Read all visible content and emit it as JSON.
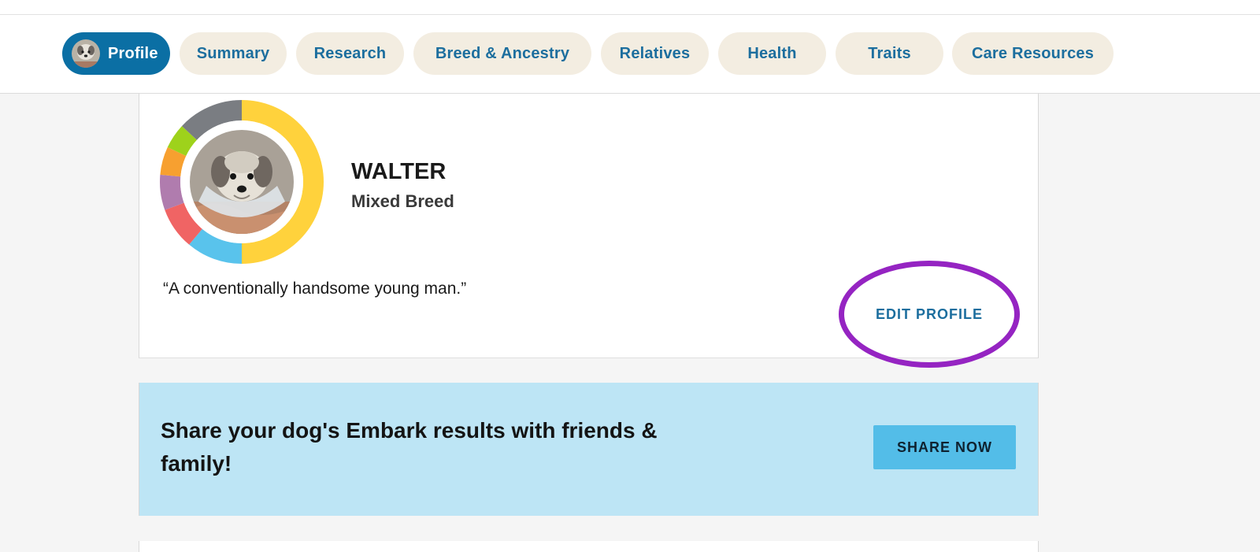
{
  "nav": {
    "tabs": [
      {
        "label": "Profile",
        "active": true
      },
      {
        "label": "Summary"
      },
      {
        "label": "Research"
      },
      {
        "label": "Breed & Ancestry"
      },
      {
        "label": "Relatives"
      },
      {
        "label": "Health"
      },
      {
        "label": "Traits"
      },
      {
        "label": "Care Resources"
      }
    ]
  },
  "profile": {
    "name": "WALTER",
    "breed": "Mixed Breed",
    "quote": "“A conventionally handsome young man.”",
    "edit_label": "EDIT PROFILE",
    "ancestry_ring_colors": [
      "#ffd23c",
      "#59c3ec",
      "#f06464",
      "#b07cae",
      "#f7a030",
      "#9ed21b",
      "#7a7d82"
    ]
  },
  "share": {
    "text": "Share your dog's Embark results with friends & family!",
    "button_label": "SHARE NOW"
  },
  "colors": {
    "nav_active": "#0b6fa4",
    "nav_inactive_bg": "#f3ede1",
    "link_blue": "#1c6e9e",
    "highlight_purple": "#9524c2",
    "share_bg": "#bde5f5",
    "share_button": "#53bde8"
  }
}
